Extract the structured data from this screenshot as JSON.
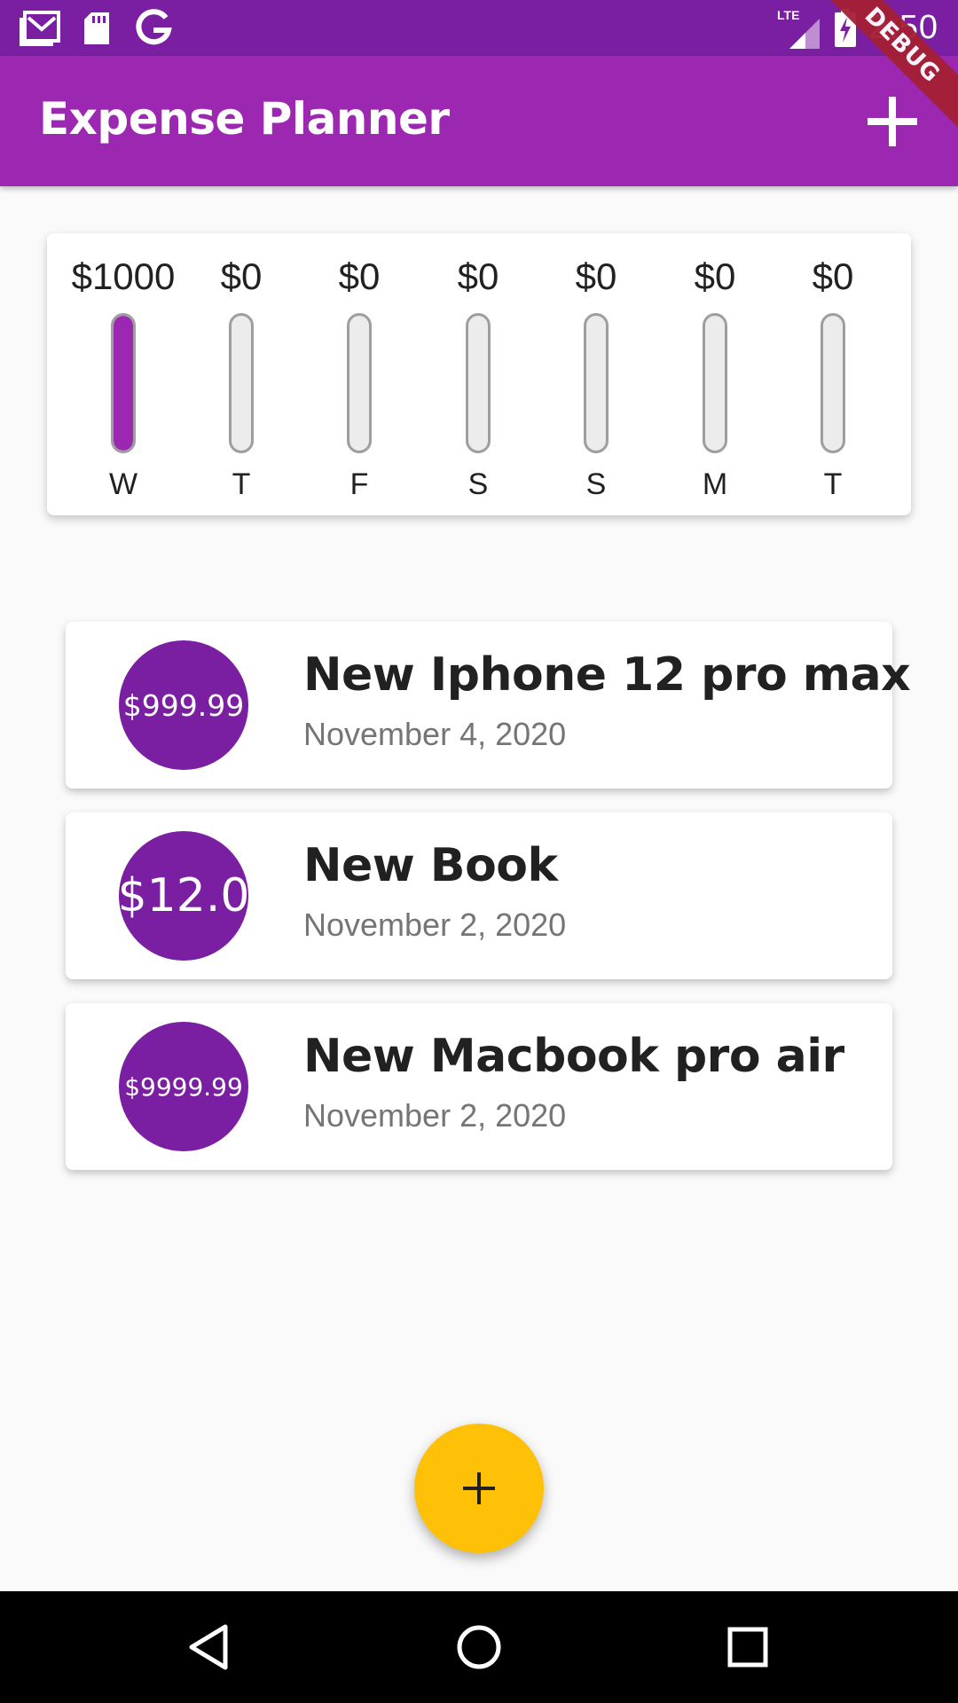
{
  "status_bar": {
    "time": "2:50",
    "network_label": "LTE",
    "left_icons": [
      "gmail-icon",
      "sd-card-icon",
      "google-icon"
    ],
    "right_icons": [
      "lte-signal-icon",
      "battery-charging-icon"
    ]
  },
  "debug_banner": {
    "label": "DEBUG",
    "color": "#a51f34"
  },
  "app_bar": {
    "title": "Expense Planner",
    "add_icon": "plus-icon",
    "color": "#9c27b0"
  },
  "chart": {
    "days": [
      {
        "label": "W",
        "amount": "$1000",
        "fill": 1.0
      },
      {
        "label": "T",
        "amount": "$0",
        "fill": 0
      },
      {
        "label": "F",
        "amount": "$0",
        "fill": 0
      },
      {
        "label": "S",
        "amount": "$0",
        "fill": 0
      },
      {
        "label": "S",
        "amount": "$0",
        "fill": 0
      },
      {
        "label": "M",
        "amount": "$0",
        "fill": 0
      },
      {
        "label": "T",
        "amount": "$0",
        "fill": 0
      }
    ],
    "fill_color": "#9c27b0"
  },
  "transactions": [
    {
      "amount": "$999.99",
      "title": "New Iphone 12 pro max",
      "date": "November 4, 2020"
    },
    {
      "amount": "$12.0",
      "title": "New Book",
      "date": "November 2, 2020"
    },
    {
      "amount": "$9999.99",
      "title": "New Macbook pro air",
      "date": "November 2, 2020"
    }
  ],
  "fab": {
    "icon": "plus-icon",
    "color": "#ffc107"
  },
  "nav_bar": {
    "buttons": [
      "back-triangle-icon",
      "home-circle-icon",
      "recents-square-icon"
    ]
  }
}
